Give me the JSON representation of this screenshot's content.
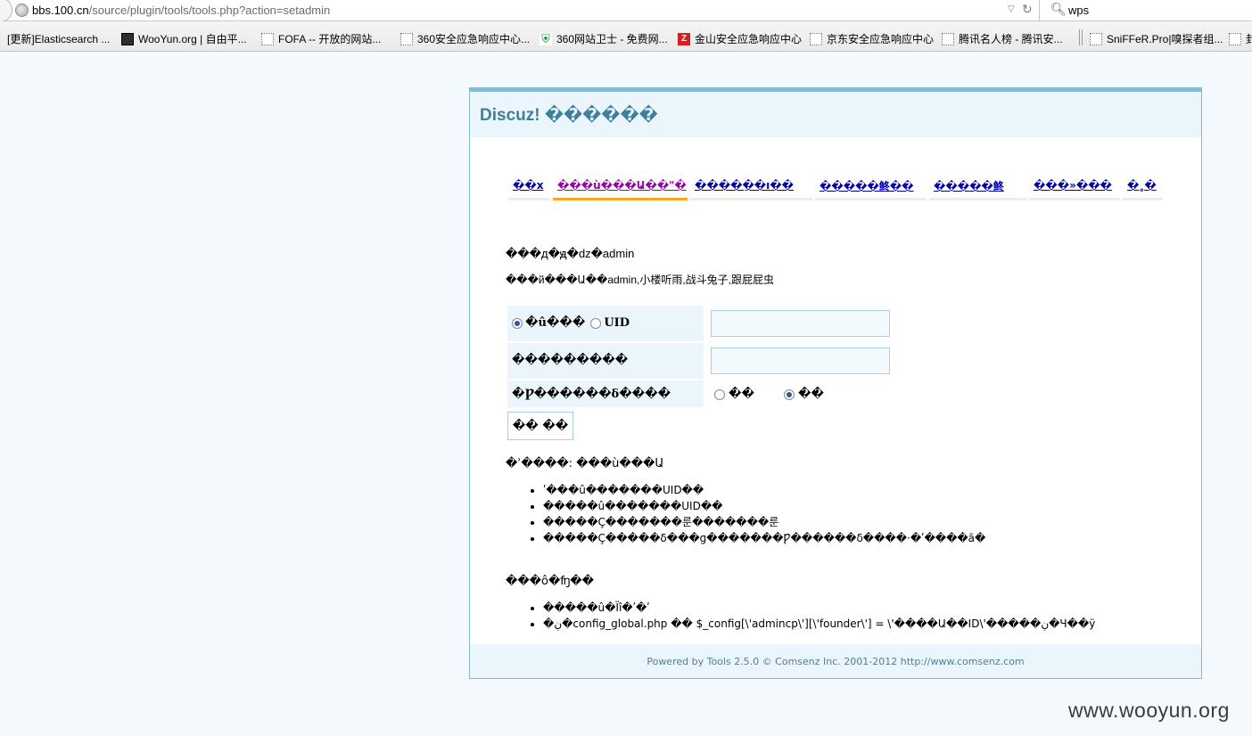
{
  "browser": {
    "url_host": "bbs.100.cn",
    "url_path": "/source/plugin/tools/tools.php?action=setadmin",
    "search_value": "wps",
    "bookmarks": [
      {
        "label": "[更新]Elasticsearch ...",
        "icon": "none"
      },
      {
        "label": "WooYun.org | 自由平...",
        "icon": "wooyun-icon"
      },
      {
        "label": "FOFA -- 开放的网站...",
        "icon": "page-icon"
      },
      {
        "label": "360安全应急响应中心...",
        "icon": "page-icon"
      },
      {
        "label": "360网站卫士 - 免费网...",
        "icon": "shield-icon"
      },
      {
        "label": "金山安全应急响应中心",
        "icon": "kingsoft-icon"
      },
      {
        "label": "京东安全应急响应中心",
        "icon": "page-icon"
      },
      {
        "label": "腾讯名人榜 - 腾讯安...",
        "icon": "page-icon"
      },
      {
        "label": "SniFFeR.Pro|嗅探者组...",
        "icon": "page-icon"
      },
      {
        "label": "封",
        "icon": "page-icon"
      }
    ]
  },
  "page": {
    "title": "Discuz! ������",
    "tabs": [
      {
        "label": "��x"
      },
      {
        "label": "���ù���Ա��\"�"
      },
      {
        "label": "�����ֵ�ı��"
      },
      {
        "label": "�����鿴��"
      },
      {
        "label": "�����鿴"
      },
      {
        "label": "���»���"
      },
      {
        "label": "�˳�"
      }
    ],
    "info_line1": "���д�ԭ�ǳ�admin",
    "info_line2": "���й���Ա��admin,小楼听雨,战斗兔子,跟屁屁虫",
    "form": {
      "radio_username": "�û���",
      "radio_uid": "UID",
      "row2_label": "���������",
      "row3_label": "�Ƿ������δ����",
      "option_no": "��",
      "option_yes": "��",
      "submit_label": "��  ��"
    },
    "tip_title": "�ʾ����: ���ù���Ա",
    "tips": [
      "ʹ���û�������UID��",
      "�����û�������UID��",
      "�����Ç�������룬�������룬",
      "�����Ç�����δ���ɡ�������Ƿ������δ����·�ʹ����ã�"
    ],
    "note_title": "���ô�ʩ��",
    "notes": [
      "�����û�Ïî�ʹ�ʹ",
      "�ڹ�config_global.php �� $_config[\\'admincp\\'][\\'founder\\'] = \\'����Ա��ID\\'�����ڹ�Ч��ÿ"
    ],
    "footer": "Powered by Tools 2.5.0 © Comsenz Inc. 2001-2012 http://www.comsenz.com"
  },
  "watermark": "www.wooyun.org"
}
